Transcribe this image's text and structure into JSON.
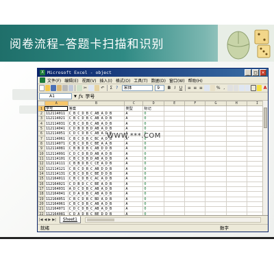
{
  "slide": {
    "title": "阅卷流程–答题卡扫描和识别",
    "watermark": "WWW.***.COM"
  },
  "window": {
    "title": "Microsoft Excel - object",
    "buttons": [
      "_",
      "□",
      "×"
    ]
  },
  "menu": [
    "文件(F)",
    "编辑(E)",
    "视图(V)",
    "插入(I)",
    "格式(O)",
    "工具(T)",
    "数据(D)",
    "窗口(W)",
    "帮助(H)"
  ],
  "toolbar": {
    "font": "宋体",
    "size": "9",
    "bold": "B",
    "italic": "I",
    "underline": "U"
  },
  "formula_bar": {
    "cell": "A1",
    "fx": "fx",
    "content": "学号"
  },
  "columns": [
    "A",
    "B",
    "C",
    "D",
    "E",
    "F",
    "G",
    "H",
    "I"
  ],
  "rows": [
    [
      "1",
      "学号",
      "答案",
      "类型",
      "标记"
    ],
    [
      "2",
      "112114011",
      "C_B_C_D_B_C_AB_A_D_B",
      "A",
      "0"
    ],
    [
      "3",
      "112114021",
      "C_B_C_D_B_C_AB_A_D_B",
      "A",
      "0"
    ],
    [
      "4",
      "112114031",
      "C_B_C_D_B_C_AB_A_D_B",
      "A",
      "0"
    ],
    [
      "5",
      "112114041",
      "C_D_B_D_B_D_AB_A_D_B",
      "A",
      "0"
    ],
    [
      "6",
      "112114051",
      "C_D_C_D_B_C_AB_A_D_B",
      "A",
      "0"
    ],
    [
      "7",
      "112114061",
      "C_B_C_D_B_C_BC_A_D_B",
      "A",
      "0"
    ],
    [
      "8",
      "112114071",
      "C_B_C_D_B_C_BE_A_A_B",
      "A",
      "0"
    ],
    [
      "9",
      "112114081",
      "C_B_B_D_B_C_AB_D_D_B",
      "A",
      "0"
    ],
    [
      "10",
      "112114091",
      "C_D_C_D_B_D_AB_A_D_B",
      "A",
      "0"
    ],
    [
      "11",
      "112114101",
      "C_B_C_D_B_D_AB_A_D_B",
      "A",
      "0"
    ],
    [
      "12",
      "112114111",
      "C_B_B_D_B_C_CE_A_D_B",
      "A",
      "0"
    ],
    [
      "13",
      "112114121",
      "C_B_C_D_B_C_AB_D_D_B",
      "A",
      "0"
    ],
    [
      "14",
      "112114131",
      "C_B_C_D_B_C_BE_D_D_B",
      "A",
      "0"
    ],
    [
      "15",
      "112164011",
      "C_B_C_D_B_C_AC_A_D_B",
      "A",
      "0"
    ],
    [
      "16",
      "112164021",
      "C_D_B_D_C_C_BE_A_D_B",
      "A",
      "0"
    ],
    [
      "17",
      "112164031",
      "A_D_C_D_B_C_AB_A_D_B",
      "A",
      "0"
    ],
    [
      "18",
      "112164041",
      "C_D_A_D_B_C_AB_A_D_B",
      "A",
      "0"
    ],
    [
      "19",
      "112164051",
      "C_B_C_D_B_C_BD_A_D_B",
      "A",
      "0"
    ],
    [
      "20",
      "112164061",
      "C_B_C_D_B_C_AB_A_D_B",
      "A",
      "0"
    ],
    [
      "21",
      "112164071",
      "C_D_C_D_B_C_AB_A_D_B",
      "A",
      "0"
    ],
    [
      "22",
      "112164081",
      "C_D_A_D_B_C_BE_D_D_B",
      "A",
      "0"
    ]
  ],
  "sheet_tabs": [
    "Sheet1"
  ],
  "status": {
    "left": "就绪",
    "right": "数字"
  },
  "colors": {
    "header_start": "#1f6f6a",
    "excel_title": "#0a246a",
    "selected_header": "#f7c66b"
  }
}
